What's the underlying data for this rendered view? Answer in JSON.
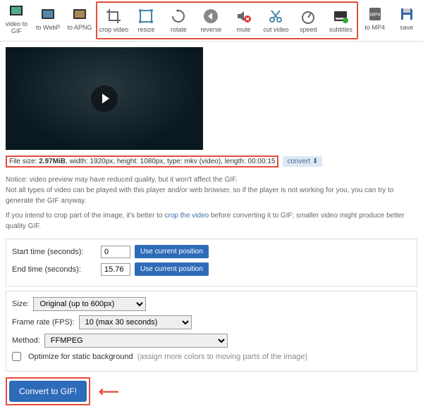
{
  "toolbar": {
    "items": [
      {
        "label": "video to GIF"
      },
      {
        "label": "to WebP"
      },
      {
        "label": "to APNG"
      },
      {
        "label": "crop video"
      },
      {
        "label": "resize"
      },
      {
        "label": "rotate"
      },
      {
        "label": "reverse"
      },
      {
        "label": "mute"
      },
      {
        "label": "cut video"
      },
      {
        "label": "speed"
      },
      {
        "label": "subtitles"
      },
      {
        "label": "to MP4"
      },
      {
        "label": "save"
      }
    ]
  },
  "fileinfo": {
    "size_label": "File size: ",
    "size_value": "2.97MiB",
    "rest": ", width: 1920px, height: 1080px, type: mkv (video), length: 00:00:15",
    "convert": "convert"
  },
  "notes": {
    "p1a": "Notice: video preview may have reduced quality, but it won't affect the GIF.",
    "p1b": "Not all types of video can be played with this player and/or web browser, so if the player is not working for you, you can try to generate the GIF anyway.",
    "p2a": "If you intend to crop part of the image, it's better to ",
    "p2link": "crop the video",
    "p2b": " before converting it to GIF; smaller video might produce better quality GIF."
  },
  "timing": {
    "start_label": "Start time (seconds):",
    "start_value": "0",
    "end_label": "End time (seconds):",
    "end_value": "15.76",
    "use_pos": "Use current position"
  },
  "options": {
    "size_label": "Size:",
    "size_value": "Original (up to 600px)",
    "fps_label": "Frame rate (FPS):",
    "fps_value": "10 (max 30 seconds)",
    "method_label": "Method:",
    "method_value": "FFMPEG",
    "optimize_label": "Optimize for static background",
    "optimize_hint": " (assign more colors to moving parts of the image)"
  },
  "submit": {
    "label": "Convert to GIF!"
  }
}
